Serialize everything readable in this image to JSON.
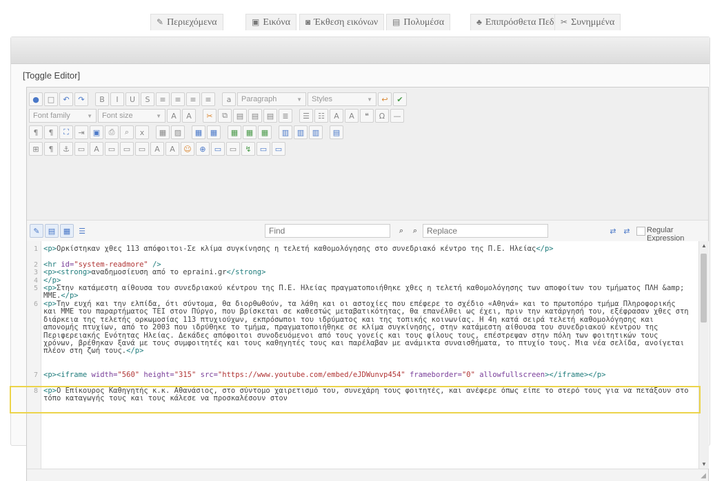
{
  "tabs": [
    {
      "icon": "edit-icon",
      "glyph": "✎",
      "label": "Περιεχόμενα"
    },
    {
      "icon": "image-icon",
      "glyph": "▣",
      "label": "Εικόνα"
    },
    {
      "icon": "camera-icon",
      "glyph": "◙",
      "label": "Έκθεση εικόνων"
    },
    {
      "icon": "media-icon",
      "glyph": "▤",
      "label": "Πολυμέσα"
    },
    {
      "icon": "fields-icon",
      "glyph": "♣",
      "label": "Επιπρόσθετα Πεδία"
    },
    {
      "icon": "attachments-icon",
      "glyph": "✂",
      "label": "Συνημμένα"
    }
  ],
  "editor": {
    "toggle_label": "[Toggle Editor]",
    "format_select": "Paragraph",
    "styles_select": "Styles",
    "font_family_select": "Font family",
    "font_size_select": "Font size"
  },
  "find": {
    "find_placeholder": "Find",
    "replace_placeholder": "Replace",
    "regex_label": "Regular Expression"
  },
  "code_lines": [
    {
      "n": "1",
      "html": "<span class='tag'>&lt;p&gt;</span>Ορκίστηκαν χθες 113 απόφοιτοι-Σε κλίμα συγκίνησης η τελετή καθομολόγησης στο συνεδριακό κέντρο της Π.Ε. Ηλείας<span class='tag'>&lt;/p&gt;</span>"
    },
    {
      "n": "2",
      "html": "<span class='tag'>&lt;hr</span> <span class='attr'>id=</span><span class='str'>\"system-readmore\"</span> <span class='tag'>/&gt;</span>"
    },
    {
      "n": "3",
      "html": "<span class='tag'>&lt;p&gt;&lt;strong&gt;</span>αναδημοσίευση από το epraini.gr<span class='tag'>&lt;/strong&gt;</span>"
    },
    {
      "n": "4",
      "html": "<span class='tag'>&lt;/p&gt;</span>"
    },
    {
      "n": "5",
      "html": "<span class='tag'>&lt;p&gt;</span>Στην κατάμεστη αίθουσα του συνεδριακού κέντρου της Π.Ε. Ηλείας πραγματοποιήθηκε χθες η τελετή καθομολόγησης των αποφοίτων του τμήματος ΠΛΗ &amp;amp; ΜΜΕ.<span class='tag'>&lt;/p&gt;</span>"
    },
    {
      "n": "6",
      "html": "<span class='tag'>&lt;p&gt;</span>Την ευχή και την ελπίδα, ότι σύντομα, θα διορθωθούν, τα λάθη και οι αστοχίες που επέφερε το σχέδιο «Αθηνά» και το πρωτοπόρο τμήμα Πληροφορικής και ΜΜΕ του παραρτήματος ΤΕΙ στον Πύργο, που βρίσκεται σε καθεστώς μεταβατικότητας, θα επανέλθει ως έχει, πριν την κατάργησή του, εξέφρασαν χθες στη διάρκεια της τελετής ορκωμοσίας 113 πτυχιούχων, εκπρόσωποι του ιδρύματος και της τοπικής κοινωνίας. Η 4η κατά σειρά τελετή καθομολόγησης και απονομής πτυχίων, από το 2003 που ιδρύθηκε το τμήμα, πραγματοποιήθηκε σε κλίμα συγκίνησης, στην κατάμεστη αίθουσα του συνεδριακού κέντρου της Περιφερειακής Ενότητας Ηλείας. Δεκάδες απόφοιτοι συνοδευόμενοι από τους γονείς και τους φίλους τους, επέστρεψαν στην πόλη των φοιτητικών τους χρόνων, βρέθηκαν ξανά με τους συμφοιτητές και τους καθηγητές τους και παρέλαβαν με ανάμικτα συναισθήματα, το πτυχίο τους. Μια νέα σελίδα, ανοίγεται πλέον στη ζωή τους.<span class='tag'>&lt;/p&gt;</span>"
    },
    {
      "n": "7",
      "html": "<span class='tag'>&lt;p&gt;&lt;iframe</span> <span class='attr'>width=</span><span class='str'>\"560\"</span> <span class='attr'>height=</span><span class='str'>\"315\"</span> <span class='attr'>src=</span><span class='str'>\"https://www.youtube.com/embed/eJDWunvp454\"</span> <span class='attr'>frameborder=</span><span class='str'>\"0\"</span> <span class='attr'>allowfullscreen</span><span class='tag'>&gt;&lt;/iframe&gt;&lt;/p&gt;</span>"
    },
    {
      "n": "8",
      "html": "<span class='tag'>&lt;p&gt;</span>Ο Επίκουρος Καθηγητής κ.κ. Αθανάσιος, στο σύντομο χαιρετισμό του, συνεχάρη τους φοιτητές, και ανέφερε όπως είπε το στερό τους για να πετάξουν στο τόπο καταγωγής τους και τους κάλεσε να προσκαλέσουν στον"
    }
  ]
}
